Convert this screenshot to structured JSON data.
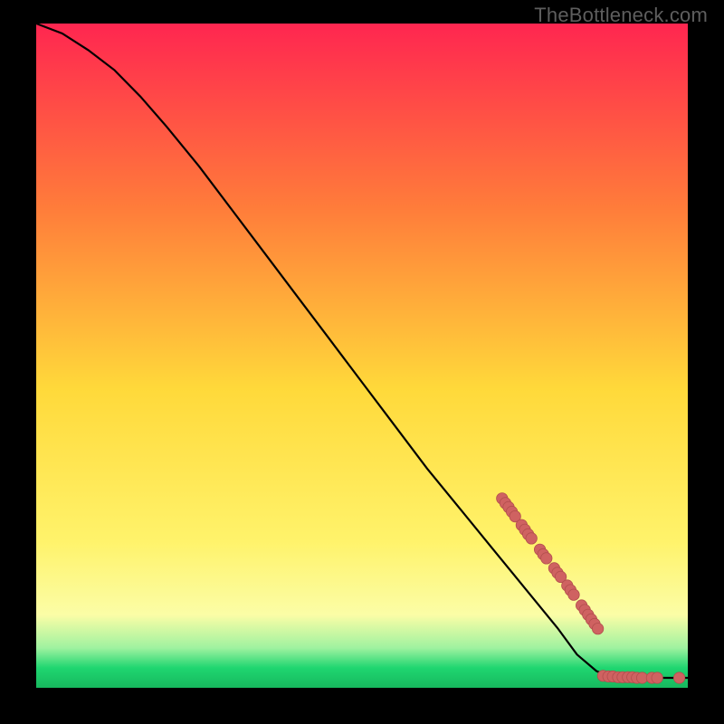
{
  "watermark": "TheBottleneck.com",
  "colors": {
    "gradient_top": "#ff2650",
    "gradient_mid_upper": "#ff7d3a",
    "gradient_mid": "#ffd93a",
    "gradient_mid_lower": "#fff36b",
    "gradient_yellow_pale": "#fbfda6",
    "gradient_green_light": "#9ff2a0",
    "gradient_green": "#1fd670",
    "gradient_green_dark": "#17b85e",
    "curve": "#000000",
    "marker_fill": "#cf6261",
    "marker_stroke": "#b24e4d"
  },
  "chart_data": {
    "type": "line",
    "title": "",
    "xlabel": "",
    "ylabel": "",
    "xlim": [
      0,
      100
    ],
    "ylim": [
      0,
      100
    ],
    "curve": [
      {
        "x": 0,
        "y": 100
      },
      {
        "x": 4,
        "y": 98.5
      },
      {
        "x": 8,
        "y": 96
      },
      {
        "x": 12,
        "y": 93
      },
      {
        "x": 16,
        "y": 89
      },
      {
        "x": 20,
        "y": 84.5
      },
      {
        "x": 25,
        "y": 78.5
      },
      {
        "x": 30,
        "y": 72
      },
      {
        "x": 35,
        "y": 65.5
      },
      {
        "x": 40,
        "y": 59
      },
      {
        "x": 45,
        "y": 52.5
      },
      {
        "x": 50,
        "y": 46
      },
      {
        "x": 55,
        "y": 39.5
      },
      {
        "x": 60,
        "y": 33
      },
      {
        "x": 65,
        "y": 27
      },
      {
        "x": 70,
        "y": 21
      },
      {
        "x": 75,
        "y": 15
      },
      {
        "x": 80,
        "y": 9
      },
      {
        "x": 83,
        "y": 5
      },
      {
        "x": 86,
        "y": 2.5
      },
      {
        "x": 88,
        "y": 1.8
      },
      {
        "x": 90,
        "y": 1.6
      },
      {
        "x": 93,
        "y": 1.5
      },
      {
        "x": 96,
        "y": 1.5
      },
      {
        "x": 100,
        "y": 1.5
      }
    ],
    "markers": [
      {
        "x": 71.5,
        "y": 28.5
      },
      {
        "x": 72.0,
        "y": 27.8
      },
      {
        "x": 72.5,
        "y": 27.2
      },
      {
        "x": 73.0,
        "y": 26.5
      },
      {
        "x": 73.5,
        "y": 25.8
      },
      {
        "x": 74.5,
        "y": 24.5
      },
      {
        "x": 75.0,
        "y": 23.8
      },
      {
        "x": 75.5,
        "y": 23.1
      },
      {
        "x": 76.0,
        "y": 22.5
      },
      {
        "x": 77.3,
        "y": 20.8
      },
      {
        "x": 77.8,
        "y": 20.1
      },
      {
        "x": 78.3,
        "y": 19.5
      },
      {
        "x": 79.5,
        "y": 18.0
      },
      {
        "x": 80.0,
        "y": 17.3
      },
      {
        "x": 80.5,
        "y": 16.7
      },
      {
        "x": 81.5,
        "y": 15.4
      },
      {
        "x": 82.0,
        "y": 14.7
      },
      {
        "x": 82.5,
        "y": 14.0
      },
      {
        "x": 83.7,
        "y": 12.4
      },
      {
        "x": 84.2,
        "y": 11.7
      },
      {
        "x": 84.7,
        "y": 11.0
      },
      {
        "x": 85.2,
        "y": 10.3
      },
      {
        "x": 85.7,
        "y": 9.6
      },
      {
        "x": 86.2,
        "y": 8.9
      },
      {
        "x": 87.0,
        "y": 1.8
      },
      {
        "x": 87.8,
        "y": 1.7
      },
      {
        "x": 88.5,
        "y": 1.7
      },
      {
        "x": 89.3,
        "y": 1.6
      },
      {
        "x": 90.0,
        "y": 1.6
      },
      {
        "x": 90.8,
        "y": 1.6
      },
      {
        "x": 91.5,
        "y": 1.6
      },
      {
        "x": 92.2,
        "y": 1.5
      },
      {
        "x": 93.0,
        "y": 1.5
      },
      {
        "x": 94.5,
        "y": 1.5
      },
      {
        "x": 95.3,
        "y": 1.5
      },
      {
        "x": 98.7,
        "y": 1.5
      }
    ]
  }
}
